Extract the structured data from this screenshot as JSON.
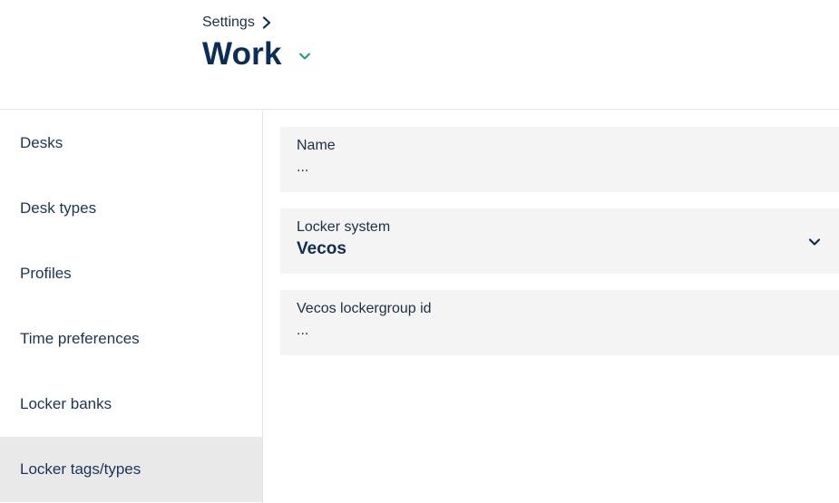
{
  "header": {
    "breadcrumb": "Settings",
    "title": "Work"
  },
  "sidebar": {
    "items": [
      {
        "label": "Desks"
      },
      {
        "label": "Desk types"
      },
      {
        "label": "Profiles"
      },
      {
        "label": "Time preferences"
      },
      {
        "label": "Locker banks"
      },
      {
        "label": "Locker tags/types",
        "active": true
      }
    ]
  },
  "form": {
    "name": {
      "label": "Name",
      "value": "..."
    },
    "locker_system": {
      "label": "Locker system",
      "value": "Vecos"
    },
    "lockergroup_id": {
      "label": "Vecos lockergroup id",
      "value": "..."
    }
  },
  "colors": {
    "title": "#0c2d57",
    "accent_green": "#1aa06d",
    "active_item_bg": "#e9e9e9",
    "field_bg": "#f4f4f4"
  },
  "icons": {
    "breadcrumb": "chevron-right-icon",
    "title_dropdown": "chevron-down-icon",
    "select": "chevron-down-icon"
  }
}
